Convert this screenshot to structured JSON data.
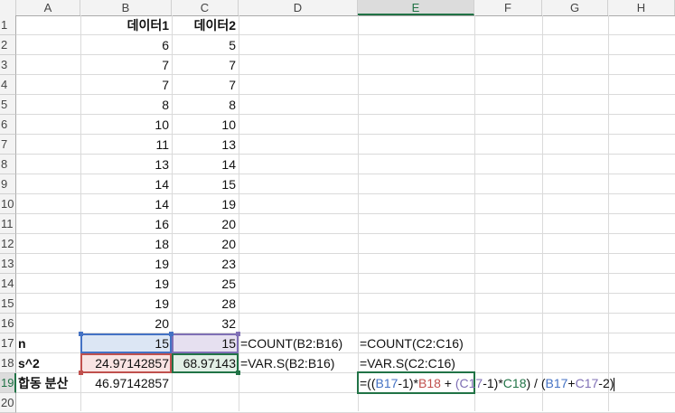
{
  "columns": [
    "A",
    "B",
    "C",
    "D",
    "E",
    "F",
    "G",
    "H"
  ],
  "rows": [
    "1",
    "2",
    "3",
    "4",
    "5",
    "6",
    "7",
    "8",
    "9",
    "10",
    "11",
    "12",
    "13",
    "14",
    "15",
    "16",
    "17",
    "18",
    "19",
    "20"
  ],
  "headers": {
    "b": "데이터1",
    "c": "데이터2"
  },
  "data1": [
    "6",
    "7",
    "7",
    "8",
    "10",
    "11",
    "13",
    "14",
    "14",
    "16",
    "18",
    "19",
    "19",
    "19",
    "20"
  ],
  "data2": [
    "5",
    "7",
    "7",
    "8",
    "10",
    "13",
    "14",
    "15",
    "19",
    "20",
    "20",
    "23",
    "25",
    "28",
    "32"
  ],
  "row17": {
    "label": "n",
    "b": "15",
    "c": "15",
    "d": "=COUNT(B2:B16)",
    "e": "=COUNT(C2:C16)"
  },
  "row18": {
    "label": "s^2",
    "b": "24.97142857",
    "c": "68.97143",
    "d": "=VAR.S(B2:B16)",
    "e": "=VAR.S(C2:C16)"
  },
  "row19": {
    "label": "합동 분산",
    "b": "46.97142857",
    "formula": {
      "p1": "=((",
      "ref1": "B17",
      "p2": "-1)*",
      "ref2": "B18",
      "p3": " + ",
      "ref3": "(C17",
      "p4": "-1)*",
      "ref4": "C18",
      "p5": ") / (",
      "ref5": "B17",
      "p6": "+",
      "ref6": "C17",
      "p7": "-2)"
    }
  },
  "colors": {
    "accent": "#217346",
    "blue": "#4472c4",
    "red": "#c0504d",
    "purple": "#7f6fb5",
    "green": "#217346"
  }
}
